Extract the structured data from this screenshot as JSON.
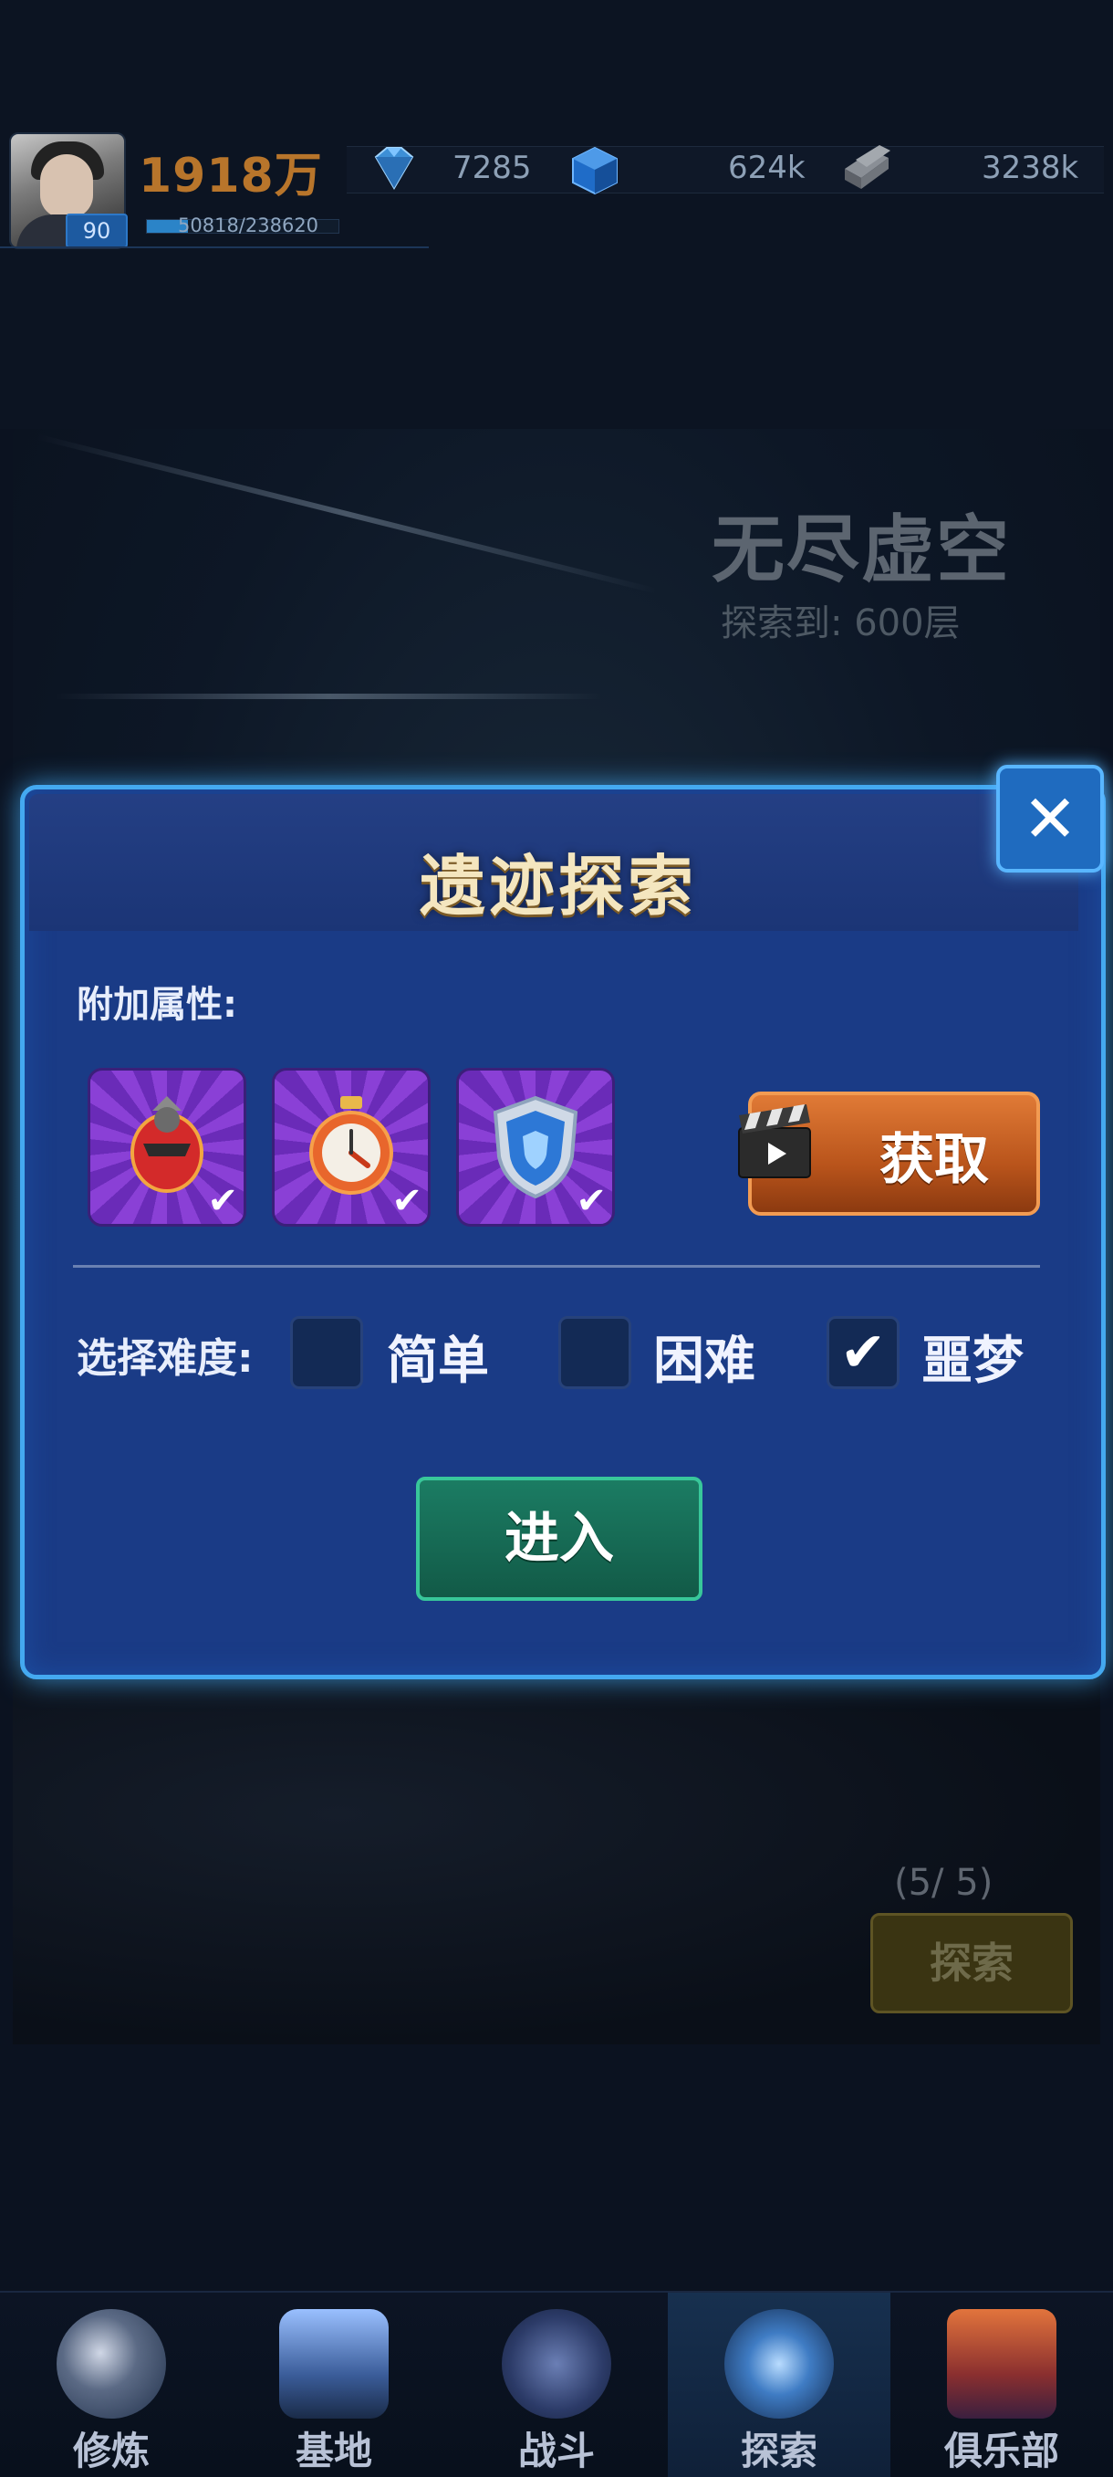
{
  "top_bar": {
    "level": "90",
    "gold": "1918万",
    "xp_text": "50818/238620",
    "xp_fraction": 0.213,
    "resources": [
      {
        "icon": "diamond-icon",
        "value": "7285"
      },
      {
        "icon": "blue-cube-icon",
        "value": "624k"
      },
      {
        "icon": "metal-ingot-icon",
        "value": "3238k"
      }
    ]
  },
  "void_section": {
    "title": "无尽虚空",
    "subtitle": "探索到: 600层"
  },
  "dialog": {
    "title": "遗迹探索",
    "attr_label": "附加属性:",
    "attributes": [
      {
        "icon": "rocket-shell-icon",
        "checked": true
      },
      {
        "icon": "stopwatch-icon",
        "checked": true
      },
      {
        "icon": "shield-icon",
        "checked": true
      }
    ],
    "get_button": "获取",
    "difficulty_label": "选择难度:",
    "difficulties": [
      {
        "label": "简单",
        "checked": false
      },
      {
        "label": "困难",
        "checked": false
      },
      {
        "label": "噩梦",
        "checked": true
      }
    ],
    "enter_button": "进入",
    "check_glyph": "✔",
    "close_glyph": "✕"
  },
  "lower_section": {
    "count": "(5/ 5)",
    "explore_button": "探索"
  },
  "nav": [
    {
      "label": "修炼",
      "icon": "molecule-icon",
      "active": false
    },
    {
      "label": "基地",
      "icon": "rocket-tower-icon",
      "active": false
    },
    {
      "label": "战斗",
      "icon": "battle-planet-icon",
      "active": false
    },
    {
      "label": "探索",
      "icon": "galaxy-icon",
      "active": true
    },
    {
      "label": "俱乐部",
      "icon": "club-banner-icon",
      "active": false
    }
  ],
  "colors": {
    "accent_blue": "#44a9f0",
    "dialog_bg": "#1a3b86",
    "get_orange": "#d0692a",
    "enter_green": "#1b7c63"
  }
}
